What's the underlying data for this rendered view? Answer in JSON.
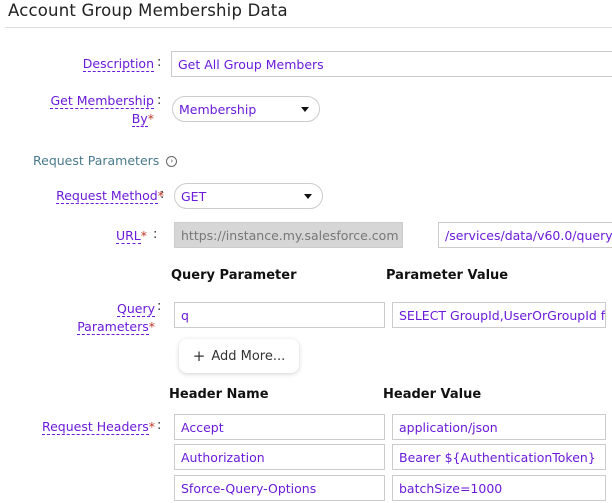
{
  "title": "Account Group Membership Data",
  "description": {
    "label": "Description",
    "value": "Get All Group Members"
  },
  "membership": {
    "label_line1": "Get Membership",
    "label_line2": "By",
    "value": "Membership"
  },
  "request_parameters": {
    "label": "Request Parameters",
    "icon": "chevron-circle-right-icon"
  },
  "method": {
    "label": "Request Method",
    "value": "GET"
  },
  "url": {
    "label": "URL",
    "base": "https://instance.my.salesforce.com",
    "path": "/services/data/v60.0/query"
  },
  "query": {
    "label_line1": "Query",
    "label_line2": "Parameters",
    "col1": "Query Parameter",
    "col2": "Parameter Value",
    "rows": [
      {
        "name": "q",
        "value": "SELECT GroupId,UserOrGroupId f"
      }
    ],
    "add_more": "Add More...",
    "add_icon": "+"
  },
  "headers": {
    "label": "Request Headers",
    "col1": "Header Name",
    "col2": "Header Value",
    "rows": [
      {
        "name": "Accept",
        "value": "application/json"
      },
      {
        "name": "Authorization",
        "value": "Bearer ${AuthenticationToken}"
      },
      {
        "name": "Sforce-Query-Options",
        "value": "batchSize=1000"
      }
    ]
  },
  "colon": ":",
  "required_mark": "*"
}
